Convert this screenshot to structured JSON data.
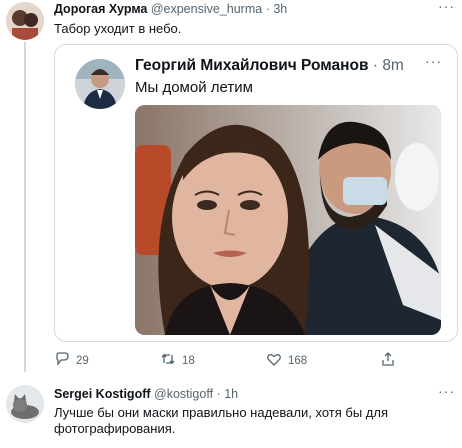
{
  "reply_tweet": {
    "author_name": "Дорогая Хурма",
    "handle": "@expensive_hurma",
    "time": "3h",
    "more_icon": "more-horizontal-icon",
    "text": "Табор уходит в небо."
  },
  "quoted_tweet": {
    "author_name": "Георгий Михайлович Романов",
    "time": "8m",
    "more_icon": "more-horizontal-icon",
    "text": "Мы домой летим"
  },
  "actions": {
    "reply_count": "29",
    "retweet_count": "18",
    "like_count": "168",
    "icons": [
      "reply-icon",
      "retweet-icon",
      "like-icon",
      "share-icon"
    ]
  },
  "second_tweet": {
    "author_name": "Sergei Kostigoff",
    "handle": "@kostigoff",
    "time": "1h",
    "more_icon": "more-horizontal-icon",
    "text": "Лучше бы они маски правильно надевали, хотя бы для фотографирования."
  }
}
